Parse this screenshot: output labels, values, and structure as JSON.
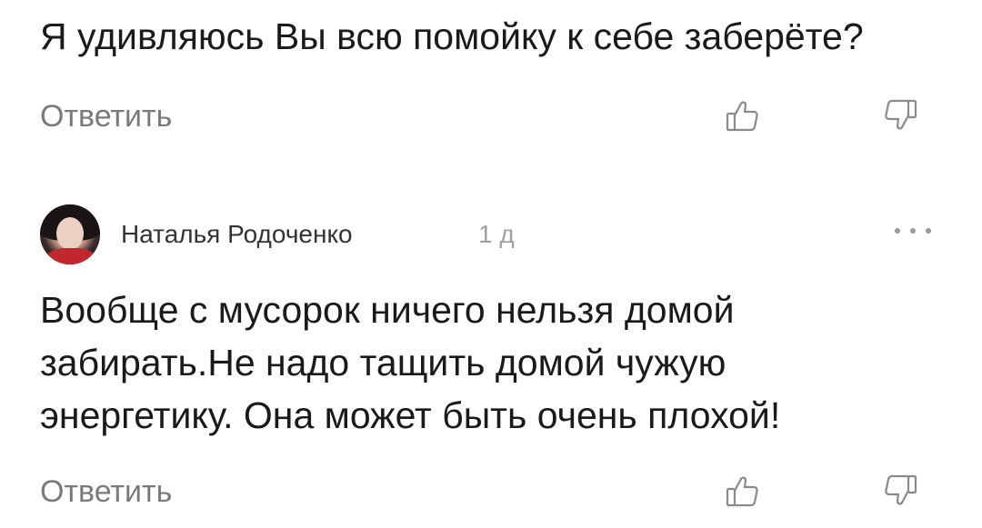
{
  "comments": [
    {
      "text": "Я удивляюсь Вы всю помойку к себе заберёте?",
      "reply_label": "Ответить",
      "like_icon": "thumbs-up-icon",
      "dislike_icon": "thumbs-down-icon"
    },
    {
      "author": "Наталья Родоченко",
      "time": "1 д",
      "avatar": "user-avatar",
      "more_icon": "more-dots-icon",
      "text_lines": [
        "Вообще с мусорок ничего нельзя домой",
        "забирать.Не надо тащить домой чужую",
        "энергетику. Она может быть очень плохой!"
      ],
      "reply_label": "Ответить",
      "like_icon": "thumbs-up-icon",
      "dislike_icon": "thumbs-down-icon"
    }
  ],
  "colors": {
    "text": "#1a1a1a",
    "secondary": "#7a7a7a",
    "muted": "#a0a0a0",
    "icon": "#8a8a8a"
  }
}
